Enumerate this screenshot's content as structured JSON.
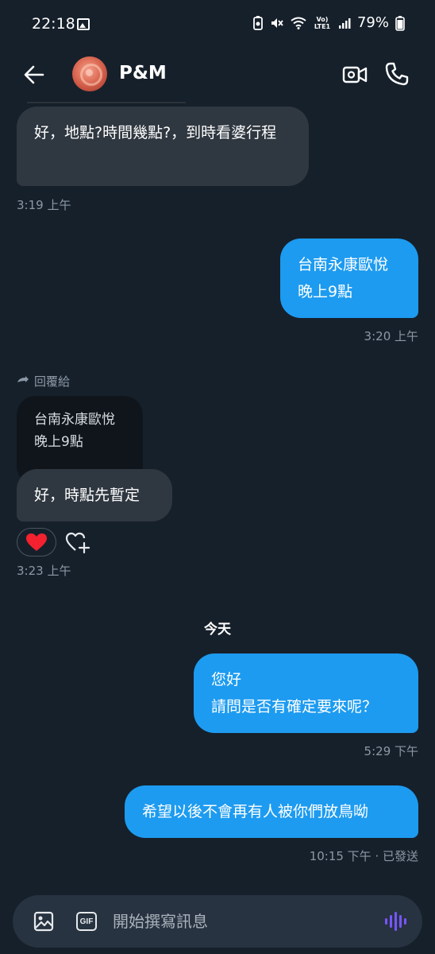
{
  "status_bar": {
    "time": "22:18",
    "battery_pct": "79%",
    "network_label": "Vo) LTE1"
  },
  "header": {
    "title": "P&M"
  },
  "messages": [
    {
      "direction": "in",
      "text": "好，地點?時間幾點?，到時看婆行程",
      "time": "3:19 上午"
    },
    {
      "direction": "out",
      "text": "台南永康歐悅\n晚上9點",
      "time": "3:20 上午"
    },
    {
      "direction": "in",
      "reply_label": "回覆給",
      "quoted": "台南永康歐悅\n晚上9點",
      "text": "好，時點先暫定",
      "reaction": "❤️",
      "time": "3:23 上午"
    },
    {
      "date_separator": "今天"
    },
    {
      "direction": "out",
      "text": "您好\n請問是否有確定要來呢？",
      "time": "5:29 下午"
    },
    {
      "direction": "out",
      "text": "希望以後不會再有人被你們放鳥呦",
      "time": "10:15 下午 · 已發送"
    }
  ],
  "composer": {
    "placeholder": "開始撰寫訊息",
    "gif_label": "GIF"
  },
  "colors": {
    "background": "#16202b",
    "incoming_bubble": "#2f3740",
    "outgoing_bubble": "#1d9bf0",
    "accent_voice": "#7856ff"
  }
}
